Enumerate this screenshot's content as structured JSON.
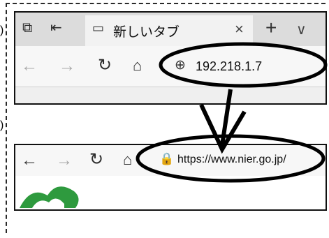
{
  "tab": {
    "title": "新しいタブ",
    "close_glyph": "×",
    "new_tab_glyph": "+",
    "menu_glyph": "∨"
  },
  "top_browser": {
    "address_text": "192.218.1.7"
  },
  "bottom_browser": {
    "address_text": "https://www.nier.go.jp/"
  },
  "icons": {
    "tab_actions": "tab-actions-icon",
    "tab_set_aside": "set-aside-tabs-icon",
    "tab_page": "page-icon",
    "back": "back-arrow-icon",
    "forward": "forward-arrow-icon",
    "refresh": "refresh-icon",
    "home": "home-icon",
    "globe": "globe-icon",
    "lock": "lock-icon"
  },
  "colors": {
    "annotation": "#000000",
    "logo_green": "#2e9a3e"
  }
}
